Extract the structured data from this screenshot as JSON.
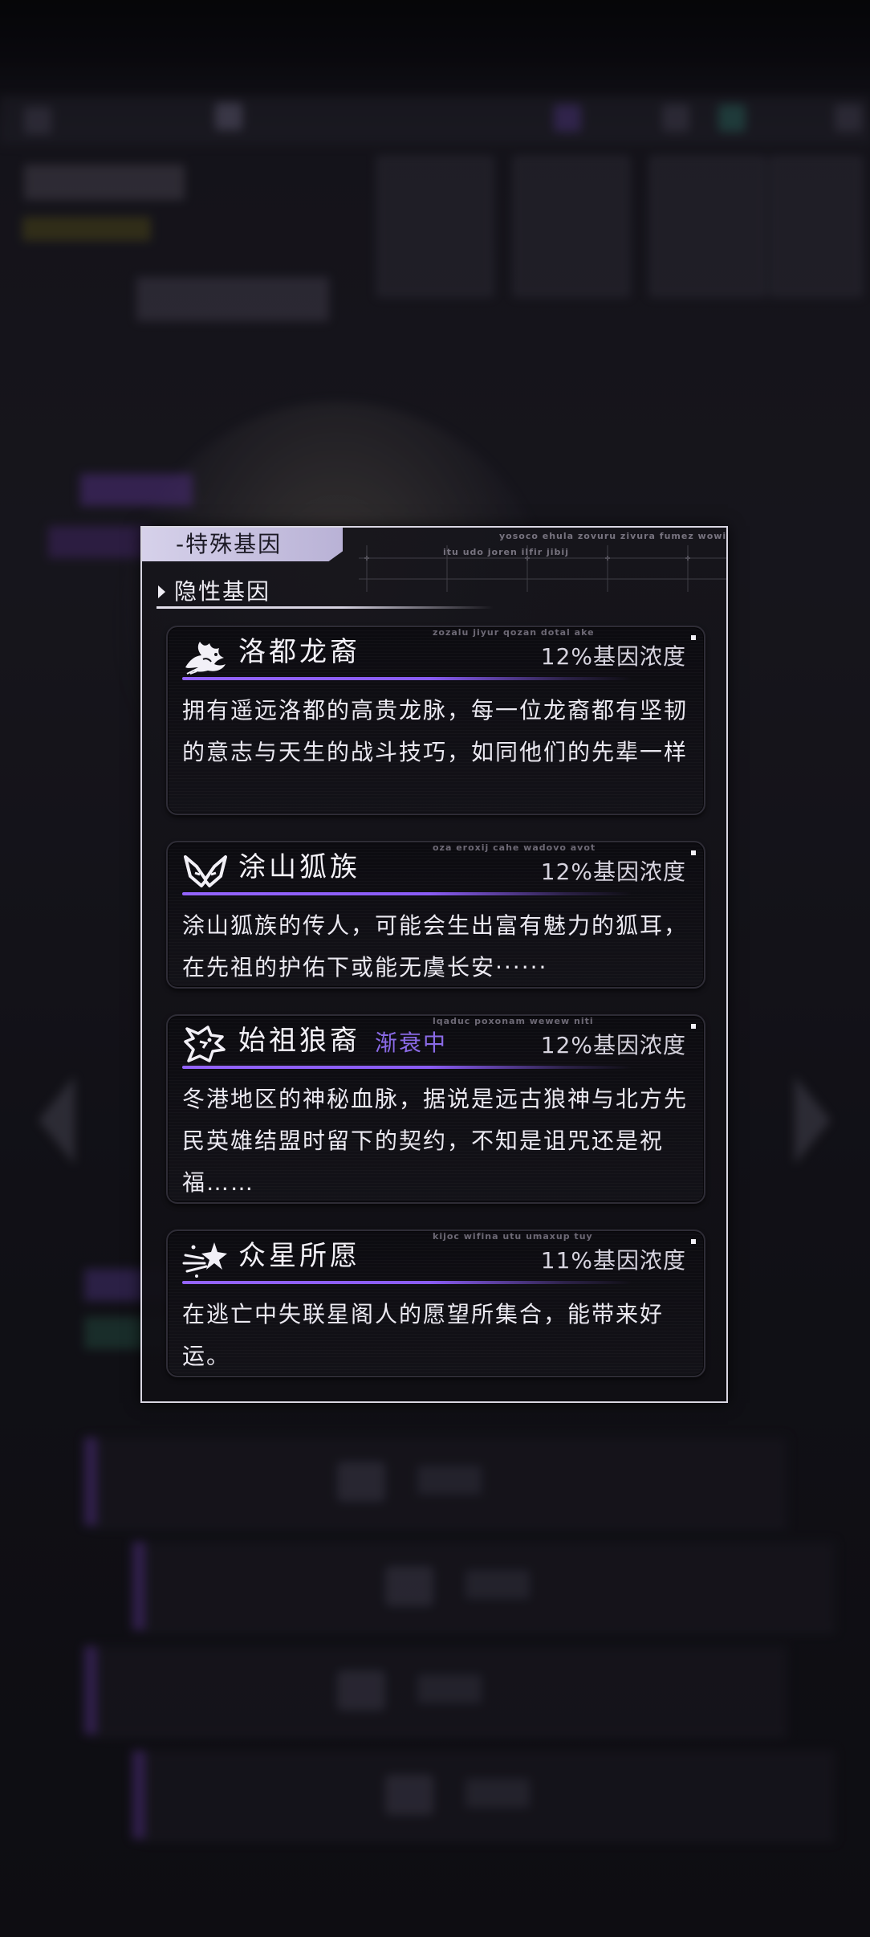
{
  "panel": {
    "tab_title": "-特殊基因",
    "deco_line1": "yosoco ehula zovuru zivura fumez wowi",
    "deco_line2": "itu udo joren ilfir jibij",
    "section_title": "隐性基因"
  },
  "genes": [
    {
      "icon": "dragon-icon",
      "name": "洛都龙裔",
      "status": "",
      "concentration": "12%基因浓度",
      "deco": "zozalu jiyur qozan dotal ake",
      "description": "拥有遥远洛都的高贵龙脉，每一位龙裔都有坚韧的意志与天生的战斗技巧，如同他们的先辈一样"
    },
    {
      "icon": "fox-icon",
      "name": "涂山狐族",
      "status": "",
      "concentration": "12%基因浓度",
      "deco": "oza eroxij cahe wadovo avot",
      "description": "涂山狐族的传人，可能会生出富有魅力的狐耳，在先祖的护佑下或能无虞长安······"
    },
    {
      "icon": "wolf-icon",
      "name": "始祖狼裔",
      "status": "渐衰中",
      "concentration": "12%基因浓度",
      "deco": "lqaduc poxonam wewew niti",
      "description": "冬港地区的神秘血脉，据说是远古狼神与北方先民英雄结盟时留下的契约，不知是诅咒还是祝福……"
    },
    {
      "icon": "shooting-star-icon",
      "name": "众星所愿",
      "status": "",
      "concentration": "11%基因浓度",
      "deco": "kijoc wifina utu umaxup tuy",
      "description": "在逃亡中失联星阁人的愿望所集合，能带来好运。"
    }
  ],
  "colors": {
    "accent_purple": "#9464ff",
    "status_purple": "#8a6ae6",
    "panel_border": "#d9d6e2",
    "tab_background": "#d6d1ea"
  }
}
